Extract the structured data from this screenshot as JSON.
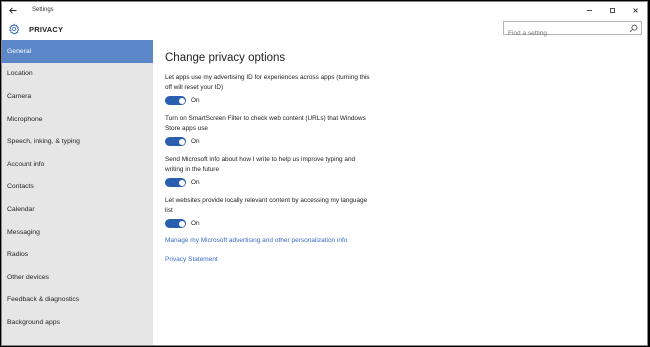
{
  "titlebar": {
    "app_title": "Settings",
    "back_icon": "back-arrow-icon",
    "controls": [
      "minimize-icon",
      "maximize-icon",
      "close-icon"
    ]
  },
  "header": {
    "icon": "gear-icon",
    "title": "PRIVACY",
    "search_placeholder": "Find a setting"
  },
  "sidebar": {
    "items": [
      {
        "label": "General",
        "active": true
      },
      {
        "label": "Location"
      },
      {
        "label": "Camera"
      },
      {
        "label": "Microphone"
      },
      {
        "label": "Speech, inking, & typing"
      },
      {
        "label": "Account info"
      },
      {
        "label": "Contacts"
      },
      {
        "label": "Calendar"
      },
      {
        "label": "Messaging"
      },
      {
        "label": "Radios"
      },
      {
        "label": "Other devices"
      },
      {
        "label": "Feedback & diagnostics"
      },
      {
        "label": "Background apps"
      }
    ]
  },
  "main": {
    "title": "Change privacy options",
    "settings": [
      {
        "description": "Let apps use my advertising ID for experiences across apps (turning this off will reset your ID)",
        "state": "On"
      },
      {
        "description": "Turn on SmartScreen Filter to check web content (URLs) that Windows Store apps use",
        "state": "On"
      },
      {
        "description": "Send Microsoft info about how I write to help us improve typing and writing in the future",
        "state": "On"
      },
      {
        "description": "Let websites provide locally relevant content by accessing my language list",
        "state": "On"
      }
    ],
    "manage_link": "Manage my Microsoft advertising and other personalization info",
    "privacy_link": "Privacy Statement"
  },
  "colors": {
    "accent": "#2a5fb0",
    "sidebar_active": "#5b86c7",
    "link": "#3a6bc4",
    "sidebar_bg": "#e6e6e6"
  }
}
